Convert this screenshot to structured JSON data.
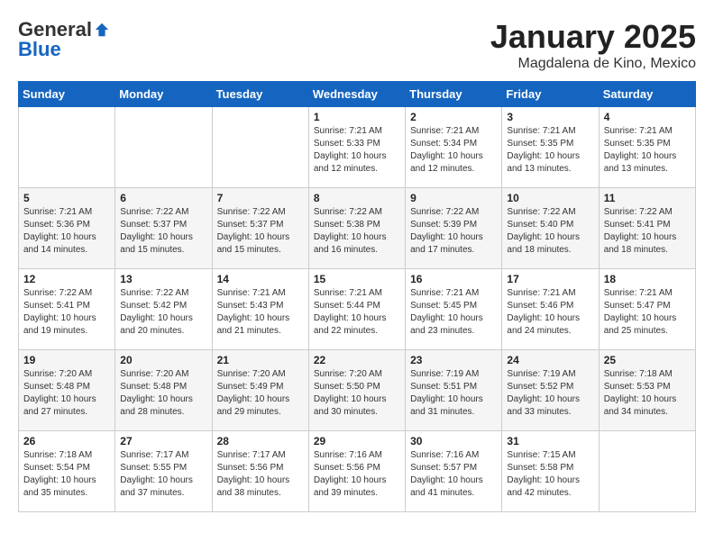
{
  "header": {
    "logo_general": "General",
    "logo_blue": "Blue",
    "title": "January 2025",
    "subtitle": "Magdalena de Kino, Mexico"
  },
  "weekdays": [
    "Sunday",
    "Monday",
    "Tuesday",
    "Wednesday",
    "Thursday",
    "Friday",
    "Saturday"
  ],
  "weeks": [
    [
      {
        "day": "",
        "sunrise": "",
        "sunset": "",
        "daylight": ""
      },
      {
        "day": "",
        "sunrise": "",
        "sunset": "",
        "daylight": ""
      },
      {
        "day": "",
        "sunrise": "",
        "sunset": "",
        "daylight": ""
      },
      {
        "day": "1",
        "sunrise": "Sunrise: 7:21 AM",
        "sunset": "Sunset: 5:33 PM",
        "daylight": "Daylight: 10 hours and 12 minutes."
      },
      {
        "day": "2",
        "sunrise": "Sunrise: 7:21 AM",
        "sunset": "Sunset: 5:34 PM",
        "daylight": "Daylight: 10 hours and 12 minutes."
      },
      {
        "day": "3",
        "sunrise": "Sunrise: 7:21 AM",
        "sunset": "Sunset: 5:35 PM",
        "daylight": "Daylight: 10 hours and 13 minutes."
      },
      {
        "day": "4",
        "sunrise": "Sunrise: 7:21 AM",
        "sunset": "Sunset: 5:35 PM",
        "daylight": "Daylight: 10 hours and 13 minutes."
      }
    ],
    [
      {
        "day": "5",
        "sunrise": "Sunrise: 7:21 AM",
        "sunset": "Sunset: 5:36 PM",
        "daylight": "Daylight: 10 hours and 14 minutes."
      },
      {
        "day": "6",
        "sunrise": "Sunrise: 7:22 AM",
        "sunset": "Sunset: 5:37 PM",
        "daylight": "Daylight: 10 hours and 15 minutes."
      },
      {
        "day": "7",
        "sunrise": "Sunrise: 7:22 AM",
        "sunset": "Sunset: 5:37 PM",
        "daylight": "Daylight: 10 hours and 15 minutes."
      },
      {
        "day": "8",
        "sunrise": "Sunrise: 7:22 AM",
        "sunset": "Sunset: 5:38 PM",
        "daylight": "Daylight: 10 hours and 16 minutes."
      },
      {
        "day": "9",
        "sunrise": "Sunrise: 7:22 AM",
        "sunset": "Sunset: 5:39 PM",
        "daylight": "Daylight: 10 hours and 17 minutes."
      },
      {
        "day": "10",
        "sunrise": "Sunrise: 7:22 AM",
        "sunset": "Sunset: 5:40 PM",
        "daylight": "Daylight: 10 hours and 18 minutes."
      },
      {
        "day": "11",
        "sunrise": "Sunrise: 7:22 AM",
        "sunset": "Sunset: 5:41 PM",
        "daylight": "Daylight: 10 hours and 18 minutes."
      }
    ],
    [
      {
        "day": "12",
        "sunrise": "Sunrise: 7:22 AM",
        "sunset": "Sunset: 5:41 PM",
        "daylight": "Daylight: 10 hours and 19 minutes."
      },
      {
        "day": "13",
        "sunrise": "Sunrise: 7:22 AM",
        "sunset": "Sunset: 5:42 PM",
        "daylight": "Daylight: 10 hours and 20 minutes."
      },
      {
        "day": "14",
        "sunrise": "Sunrise: 7:21 AM",
        "sunset": "Sunset: 5:43 PM",
        "daylight": "Daylight: 10 hours and 21 minutes."
      },
      {
        "day": "15",
        "sunrise": "Sunrise: 7:21 AM",
        "sunset": "Sunset: 5:44 PM",
        "daylight": "Daylight: 10 hours and 22 minutes."
      },
      {
        "day": "16",
        "sunrise": "Sunrise: 7:21 AM",
        "sunset": "Sunset: 5:45 PM",
        "daylight": "Daylight: 10 hours and 23 minutes."
      },
      {
        "day": "17",
        "sunrise": "Sunrise: 7:21 AM",
        "sunset": "Sunset: 5:46 PM",
        "daylight": "Daylight: 10 hours and 24 minutes."
      },
      {
        "day": "18",
        "sunrise": "Sunrise: 7:21 AM",
        "sunset": "Sunset: 5:47 PM",
        "daylight": "Daylight: 10 hours and 25 minutes."
      }
    ],
    [
      {
        "day": "19",
        "sunrise": "Sunrise: 7:20 AM",
        "sunset": "Sunset: 5:48 PM",
        "daylight": "Daylight: 10 hours and 27 minutes."
      },
      {
        "day": "20",
        "sunrise": "Sunrise: 7:20 AM",
        "sunset": "Sunset: 5:48 PM",
        "daylight": "Daylight: 10 hours and 28 minutes."
      },
      {
        "day": "21",
        "sunrise": "Sunrise: 7:20 AM",
        "sunset": "Sunset: 5:49 PM",
        "daylight": "Daylight: 10 hours and 29 minutes."
      },
      {
        "day": "22",
        "sunrise": "Sunrise: 7:20 AM",
        "sunset": "Sunset: 5:50 PM",
        "daylight": "Daylight: 10 hours and 30 minutes."
      },
      {
        "day": "23",
        "sunrise": "Sunrise: 7:19 AM",
        "sunset": "Sunset: 5:51 PM",
        "daylight": "Daylight: 10 hours and 31 minutes."
      },
      {
        "day": "24",
        "sunrise": "Sunrise: 7:19 AM",
        "sunset": "Sunset: 5:52 PM",
        "daylight": "Daylight: 10 hours and 33 minutes."
      },
      {
        "day": "25",
        "sunrise": "Sunrise: 7:18 AM",
        "sunset": "Sunset: 5:53 PM",
        "daylight": "Daylight: 10 hours and 34 minutes."
      }
    ],
    [
      {
        "day": "26",
        "sunrise": "Sunrise: 7:18 AM",
        "sunset": "Sunset: 5:54 PM",
        "daylight": "Daylight: 10 hours and 35 minutes."
      },
      {
        "day": "27",
        "sunrise": "Sunrise: 7:17 AM",
        "sunset": "Sunset: 5:55 PM",
        "daylight": "Daylight: 10 hours and 37 minutes."
      },
      {
        "day": "28",
        "sunrise": "Sunrise: 7:17 AM",
        "sunset": "Sunset: 5:56 PM",
        "daylight": "Daylight: 10 hours and 38 minutes."
      },
      {
        "day": "29",
        "sunrise": "Sunrise: 7:16 AM",
        "sunset": "Sunset: 5:56 PM",
        "daylight": "Daylight: 10 hours and 39 minutes."
      },
      {
        "day": "30",
        "sunrise": "Sunrise: 7:16 AM",
        "sunset": "Sunset: 5:57 PM",
        "daylight": "Daylight: 10 hours and 41 minutes."
      },
      {
        "day": "31",
        "sunrise": "Sunrise: 7:15 AM",
        "sunset": "Sunset: 5:58 PM",
        "daylight": "Daylight: 10 hours and 42 minutes."
      },
      {
        "day": "",
        "sunrise": "",
        "sunset": "",
        "daylight": ""
      }
    ]
  ]
}
